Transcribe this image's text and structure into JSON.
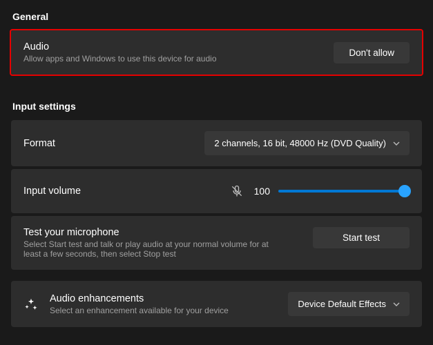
{
  "general": {
    "header": "General",
    "audio": {
      "title": "Audio",
      "subtitle": "Allow apps and Windows to use this device for audio",
      "button": "Don't allow"
    }
  },
  "input": {
    "header": "Input settings",
    "format": {
      "label": "Format",
      "selected": "2 channels, 16 bit, 48000 Hz (DVD Quality)"
    },
    "volume": {
      "label": "Input volume",
      "value": "100"
    },
    "mictest": {
      "title": "Test your microphone",
      "subtitle": "Select Start test and talk or play audio at your normal volume for at least a few seconds, then select Stop test",
      "button": "Start test"
    }
  },
  "enhancements": {
    "title": "Audio enhancements",
    "subtitle": "Select an enhancement available for your device",
    "selected": "Device Default Effects"
  }
}
